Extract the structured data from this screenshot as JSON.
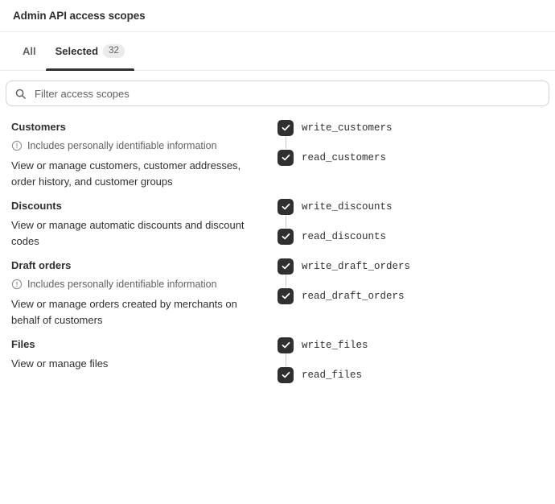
{
  "header": {
    "title": "Admin API access scopes"
  },
  "tabs": [
    {
      "label": "All",
      "active": false,
      "badge": null,
      "name": "tab-all"
    },
    {
      "label": "Selected",
      "active": true,
      "badge": "32",
      "name": "tab-selected"
    }
  ],
  "search": {
    "placeholder": "Filter access scopes",
    "value": "",
    "icon": "search-icon"
  },
  "icons": {
    "pii": "alert-circle-icon",
    "check": "check-icon"
  },
  "pii_notice": "Includes personally identifiable information",
  "colors": {
    "checkbox_fill": "#303030",
    "checkbox_check": "#ffffff",
    "tab_underline": "#303030",
    "badge_bg": "#ebebeb",
    "border": "#ebebeb",
    "input_border": "#d4d4d4",
    "text_primary": "#303030",
    "text_secondary": "#616161",
    "connector": "#c9c9c9"
  },
  "groups": [
    {
      "name": "Customers",
      "pii": true,
      "description": "View or manage customers, customer addresses, order history, and customer groups",
      "scopes": [
        {
          "label": "write_customers",
          "checked": true
        },
        {
          "label": "read_customers",
          "checked": true
        }
      ]
    },
    {
      "name": "Discounts",
      "pii": false,
      "description": "View or manage automatic discounts and discount codes",
      "scopes": [
        {
          "label": "write_discounts",
          "checked": true
        },
        {
          "label": "read_discounts",
          "checked": true
        }
      ]
    },
    {
      "name": "Draft orders",
      "pii": true,
      "description": "View or manage orders created by merchants on behalf of customers",
      "scopes": [
        {
          "label": "write_draft_orders",
          "checked": true
        },
        {
          "label": "read_draft_orders",
          "checked": true
        }
      ]
    },
    {
      "name": "Files",
      "pii": false,
      "description": "View or manage files",
      "scopes": [
        {
          "label": "write_files",
          "checked": true
        },
        {
          "label": "read_files",
          "checked": true
        }
      ]
    }
  ]
}
